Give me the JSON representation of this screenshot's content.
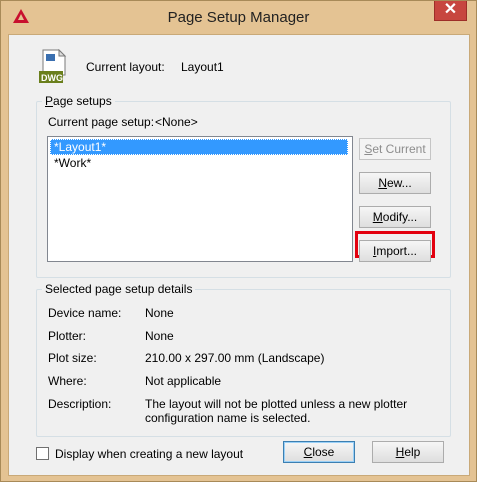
{
  "window": {
    "title": "Page Setup Manager",
    "close_glyph": "✕",
    "close_color": "#c7463f"
  },
  "icons": {
    "app": "autocad-logo-icon",
    "file": "dwg-file-icon"
  },
  "header": {
    "current_layout_label": "Current layout:",
    "current_layout_value": "Layout1",
    "dwg_badge": "DWG"
  },
  "page_setups": {
    "legend": "Page setups",
    "current_label": "Current page setup:",
    "current_value": "<None>",
    "items": [
      "*Layout1*",
      "*Work*"
    ],
    "selected_index": 0,
    "buttons": {
      "set_current": {
        "pre": "",
        "key": "S",
        "post": "et Current"
      },
      "new": {
        "pre": "",
        "key": "N",
        "post": "ew..."
      },
      "modify": {
        "pre": "",
        "key": "M",
        "post": "odify..."
      },
      "import": {
        "pre": "",
        "key": "I",
        "post": "mport..."
      }
    }
  },
  "details": {
    "legend": "Selected page setup details",
    "rows": [
      {
        "label": "Device name:",
        "value": "None"
      },
      {
        "label": "Plotter:",
        "value": "None"
      },
      {
        "label": "Plot size:",
        "value": "210.00 x 297.00 mm (Landscape)"
      },
      {
        "label": "Where:",
        "value": "Not applicable"
      },
      {
        "label": "Description:",
        "value": "The layout will not be plotted unless a new plotter configuration name is selected."
      }
    ]
  },
  "footer": {
    "checkbox_label": "Display when creating a new layout",
    "checkbox_checked": false,
    "close": {
      "pre": "",
      "key": "C",
      "post": "lose"
    },
    "help": {
      "pre": "",
      "key": "H",
      "post": "elp"
    }
  },
  "colors": {
    "selection": "#3399ff",
    "highlight": "#e3000f",
    "frame": "#e4c393"
  }
}
